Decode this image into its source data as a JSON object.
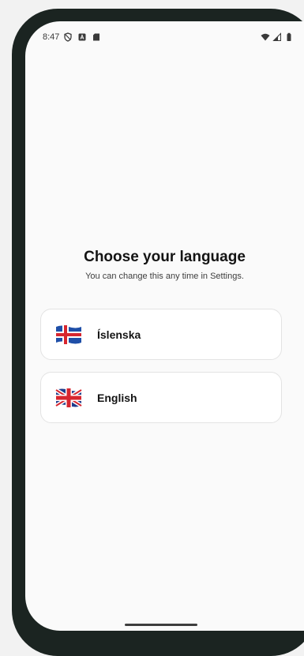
{
  "status_bar": {
    "time": "8:47",
    "left_icons": [
      "shield-icon",
      "notification-a-icon",
      "sd-card-icon"
    ],
    "right_icons": [
      "wifi-icon",
      "cell-signal-icon",
      "battery-icon"
    ]
  },
  "language_screen": {
    "title": "Choose your language",
    "subtitle": "You can change this any time in Settings.",
    "options": [
      {
        "label": "Íslenska",
        "flag_icon": "iceland-flag-icon"
      },
      {
        "label": "English",
        "flag_icon": "uk-flag-icon"
      }
    ]
  },
  "colors": {
    "frame": "#1b2421",
    "screen_background": "#fafafa",
    "card_background": "#ffffff",
    "card_border": "#e3e3e3",
    "text_primary": "#141414"
  }
}
